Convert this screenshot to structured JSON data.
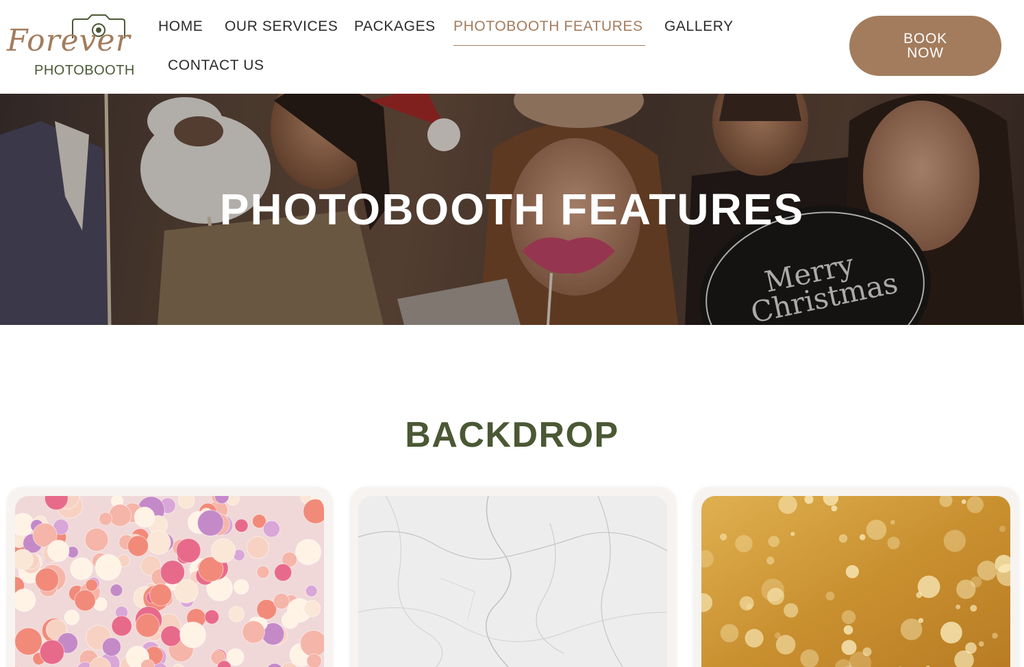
{
  "logo": {
    "script_text": "Forever",
    "sub_text": "PHOTOBOOTH",
    "icon": "camera-icon"
  },
  "nav": {
    "items": [
      {
        "label": "HOME"
      },
      {
        "label": "OUR SERVICES"
      },
      {
        "label": "PACKAGES"
      },
      {
        "label": "PHOTOBOOTH FEATURES",
        "active": true
      },
      {
        "label": "GALLERY"
      },
      {
        "label": "CONTACT US"
      }
    ]
  },
  "cta": {
    "line1": "BOOK",
    "line2": "NOW"
  },
  "hero": {
    "title": "PHOTOBOOTH FEATURES",
    "sign_line1": "Merry",
    "sign_line2": "Christmas"
  },
  "backdrop": {
    "title": "BACKDROP",
    "cards": [
      {
        "image": "flower-wall-backdrop"
      },
      {
        "image": "white-marble-backdrop"
      },
      {
        "image": "gold-glitter-backdrop"
      }
    ]
  },
  "colors": {
    "brand_brown": "#a37c5d",
    "brand_green": "#4a5834",
    "text_dark": "#2b2b2b"
  }
}
